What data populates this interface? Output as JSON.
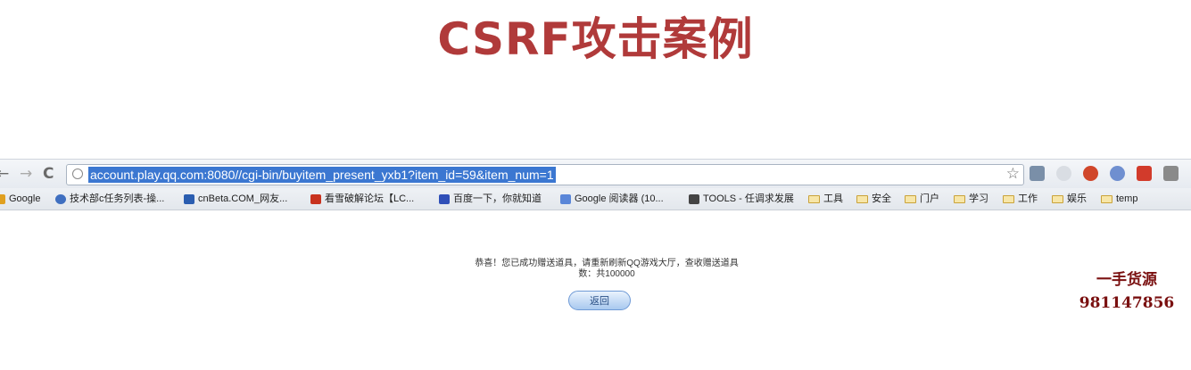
{
  "slide": {
    "title": "CSRF攻击案例"
  },
  "browser": {
    "nav": {
      "back": "←",
      "forward": "→",
      "reload": "C"
    },
    "url": "account.play.qq.com:8080//cgi-bin/buyitem_present_yxb1?item_id=59&item_num=1",
    "star": "☆",
    "bookmarks": [
      {
        "label": "Google",
        "icon": "google-icon"
      },
      {
        "label": "技术部c任务列表-操...",
        "icon": "globe-icon"
      },
      {
        "label": "cnBeta.COM_网友...",
        "icon": "cnbeta-icon"
      },
      {
        "label": "看雪破解论坛【LC...",
        "icon": "kanxue-icon"
      },
      {
        "label": "百度一下，你就知道",
        "icon": "baidu-icon"
      },
      {
        "label": "Google 阅读器 (10...",
        "icon": "reader-icon"
      },
      {
        "label": "TOOLS - 任调求发展",
        "icon": "tools-icon"
      },
      {
        "label": "工具",
        "icon": "folder-icon"
      },
      {
        "label": "安全",
        "icon": "folder-icon"
      },
      {
        "label": "门户",
        "icon": "folder-icon"
      },
      {
        "label": "学习",
        "icon": "folder-icon"
      },
      {
        "label": "工作",
        "icon": "folder-icon"
      },
      {
        "label": "娱乐",
        "icon": "folder-icon"
      },
      {
        "label": "temp",
        "icon": "folder-icon"
      }
    ]
  },
  "page": {
    "message_line1": "恭喜！您已成功赠送道具，请重新刷新QQ游戏大厅，查收赠送道具",
    "message_line2": "数：共100000",
    "back_button": "返回"
  },
  "watermark": {
    "line1": "一手货源",
    "line2": "981147856"
  },
  "colors": {
    "title": "#b03a3a",
    "url_highlight": "#3b77d1",
    "watermark": "#7a1010"
  }
}
